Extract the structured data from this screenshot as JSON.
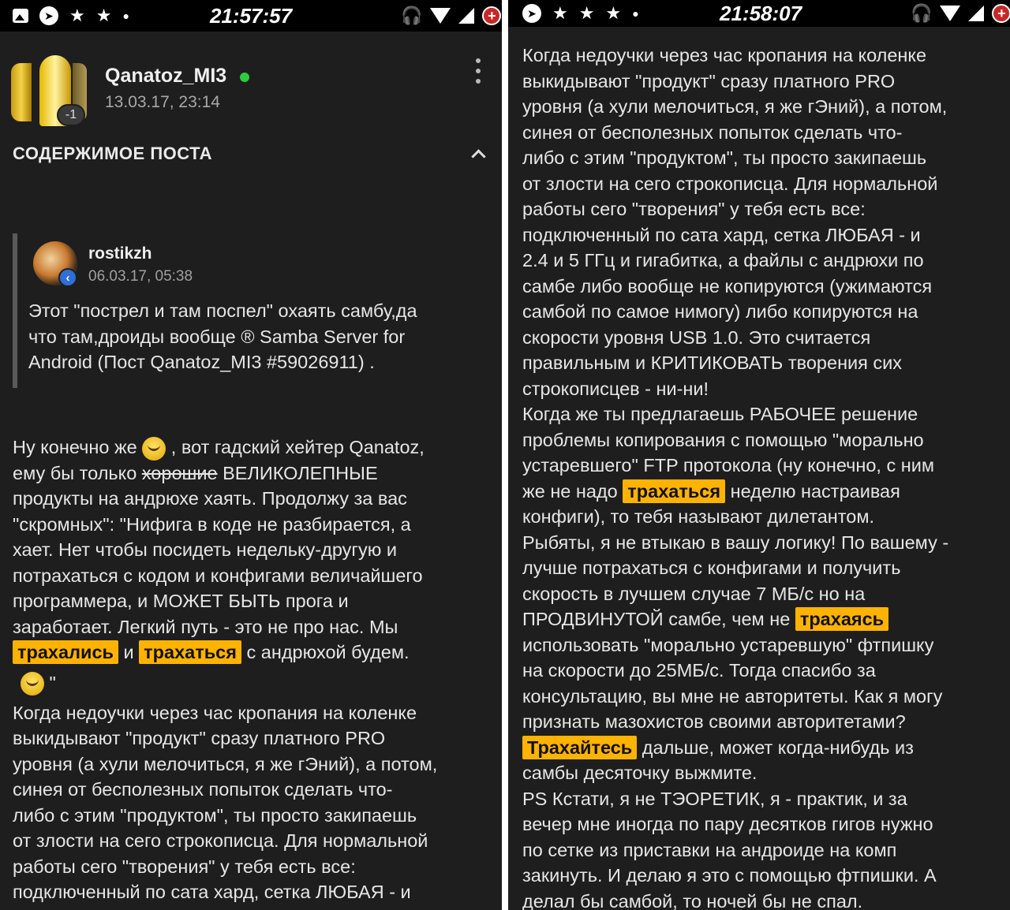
{
  "left": {
    "status": {
      "time": "21:57:57"
    },
    "post": {
      "author": "Qanatoz_MI3",
      "date": "13.03.17, 23:14",
      "reputation": "-1",
      "section_title": "СОДЕРЖИМОЕ ПОСТА",
      "quote": {
        "author": "rostikzh",
        "date": "06.03.17, 05:38",
        "lines": [
          "Этот \"пострел и там поспел\" охаять самбу,да",
          "что там,дроиды вообще ® Samba Server for",
          "Android (Пост Qanatoz_MI3 #59026911) ."
        ]
      },
      "body": {
        "l1a": "Ну конечно же ",
        "l1b": " , вот гадский хейтер Qanatoz,",
        "l2a": "ему бы только ",
        "l2strike": "хорошие",
        "l2b": " ВЕЛИКОЛЕПНЫЕ",
        "l3": "продукты на андрюхе хаять. Продолжу за вас",
        "l4": "\"скромных\": \"Нифига в коде не разбирается, а",
        "l5": "хает. Нет чтобы посидеть недельку-другую и",
        "l6": "потрахаться с кодом и конфигами величайшего",
        "l7": "программера, и МОЖЕТ БЫТЬ прога и",
        "l8": "заработает. Легкий путь - это не про нас. Мы",
        "l9hl1": "трахались",
        "l9mid": " и ",
        "l9hl2": "трахаться",
        "l9b": " с андрюхой будем.",
        "l10": " \"",
        "rest": [
          "Когда недоучки через час кропания на коленке",
          "выкидывают \"продукт\" сразу платного PRO",
          "уровня (а хули мелочиться, я же гЭний), а потом,",
          "синея от бесполезных попыток сделать что-",
          "либо с этим \"продуктом\", ты просто закипаешь",
          "от злости на сего строкописца. Для нормальной",
          "работы сего \"творения\" у тебя есть все:",
          "подключенный по сата хард, сетка ЛЮБАЯ - и"
        ]
      }
    }
  },
  "right": {
    "status": {
      "time": "21:58:07"
    },
    "lines": [
      "Когда недоучки через час кропания на коленке",
      "выкидывают \"продукт\" сразу платного PRO",
      "уровня (а хули мелочиться, я же гЭний), а потом,",
      "синея от бесполезных попыток сделать что-",
      "либо с этим \"продуктом\", ты просто закипаешь",
      "от злости на сего строкописца. Для нормальной",
      "работы сего \"творения\" у тебя есть все:",
      "подключенный по сата хард, сетка ЛЮБАЯ - и",
      "2.4 и 5 ГГц и гигабитка, а файлы с андрюхи по",
      "самбе либо вообще не копируются (ужимаются",
      "самбой по самое нимогу) либо копируются на",
      "скорости уровня USB 1.0. Это считается",
      "правильным и КРИТИКОВАТЬ творения сих",
      "строкописцев - ни-ни!",
      "Когда же ты предлагаешь РАБОЧЕЕ решение",
      "проблемы копирования с помощью \"морально",
      "устаревшего\" FTP протокола (ну конечно, с ним"
    ],
    "l18a": "же не надо ",
    "l18hl": "трахаться",
    "l18b": " неделю настраивая",
    "lines2": [
      "конфиги), то тебя называют дилетантом.",
      "Рыбяты, я не втыкаю в вашу логику! По вашему -",
      "лучше потрахаться с конфигами и получить",
      "скорость в лучшем случае 7 МБ/с но на"
    ],
    "l23a": "ПРОДВИНУТОЙ самбе, чем не ",
    "l23hl": "трахаясь",
    "lines3": [
      "использовать \"морально устаревшую\" фтпишку",
      "на скорости до 25МБ/с. Тогда спасибо за",
      "консультацию, вы мне не авторитеты. Как я могу",
      "признать мазохистов своими авторитетами?"
    ],
    "l28hl": "Трахайтесь",
    "l28b": " дальше, может когда-нибудь из",
    "lines4": [
      "самбы десяточку выжмите.",
      "PS Кстати, я не ТЭОРЕТИК, я - практик, и за",
      "вечер мне иногда по пару десятков гигов нужно",
      "по сетке из приставки на андроиде на комп",
      "закинуть. И делаю я это с помощью фтпишки. А",
      "делал бы самбой, то ночей бы не спал."
    ]
  },
  "colors": {
    "highlight": "#ffb300",
    "background": "#1e1e1e",
    "online": "#2ecc40"
  }
}
